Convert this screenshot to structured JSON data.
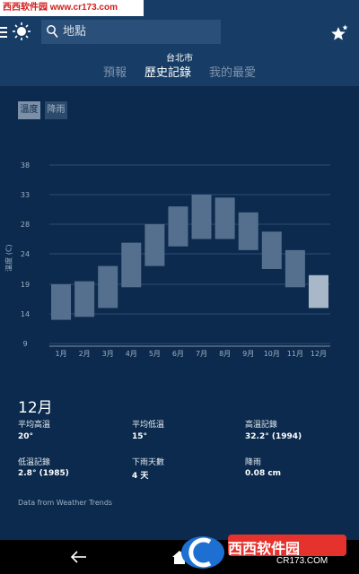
{
  "watermark": {
    "top_text": "西西软件园 www.cr173.com",
    "bottom_text": "西西软件园",
    "bottom_url": "CR173.COM"
  },
  "header": {
    "search_placeholder": "地點",
    "city": "台北市",
    "tabs": [
      {
        "label": "預報",
        "active": false
      },
      {
        "label": "歷史記錄",
        "active": true
      },
      {
        "label": "我的最愛",
        "active": false
      }
    ]
  },
  "chart_toggles": {
    "temperature": "溫度",
    "rain": "降雨"
  },
  "chart_data": {
    "type": "range_bar",
    "ylabel": "溫度 (C)",
    "yticks": [
      38,
      33,
      28,
      24,
      19,
      14,
      9
    ],
    "ylim": [
      9,
      38
    ],
    "grid": true,
    "categories": [
      "1月",
      "2月",
      "3月",
      "4月",
      "5月",
      "6月",
      "7月",
      "8月",
      "9月",
      "10月",
      "11月",
      "12月"
    ],
    "lows": [
      13,
      13.5,
      15,
      18.5,
      22,
      25,
      26,
      26,
      24.5,
      21.5,
      18.5,
      15
    ],
    "highs": [
      19,
      19.5,
      22,
      25.5,
      28,
      31,
      33,
      32.5,
      30,
      27,
      24.5,
      20.5
    ],
    "selected_index": 11,
    "bar_color": "#55708f",
    "selected_color": "#a9b8c8"
  },
  "summary": {
    "month": "12月",
    "stats": [
      {
        "label": "平均高溫",
        "value": "20°"
      },
      {
        "label": "平均低溫",
        "value": "15°"
      },
      {
        "label": "高溫記錄",
        "value": "32.2° (1994)"
      },
      {
        "label": "低溫記錄",
        "value": "2.8° (1985)"
      },
      {
        "label": "下雨天數",
        "value": "4 天"
      },
      {
        "label": "降雨",
        "value": "0.08 cm"
      }
    ],
    "source": "Data from Weather Trends"
  },
  "icons": {
    "menu": "menu-icon",
    "sun": "sun-icon",
    "search": "search-icon",
    "favorite": "favorite-star-icon",
    "back": "back-arrow-icon",
    "home": "home-icon"
  }
}
